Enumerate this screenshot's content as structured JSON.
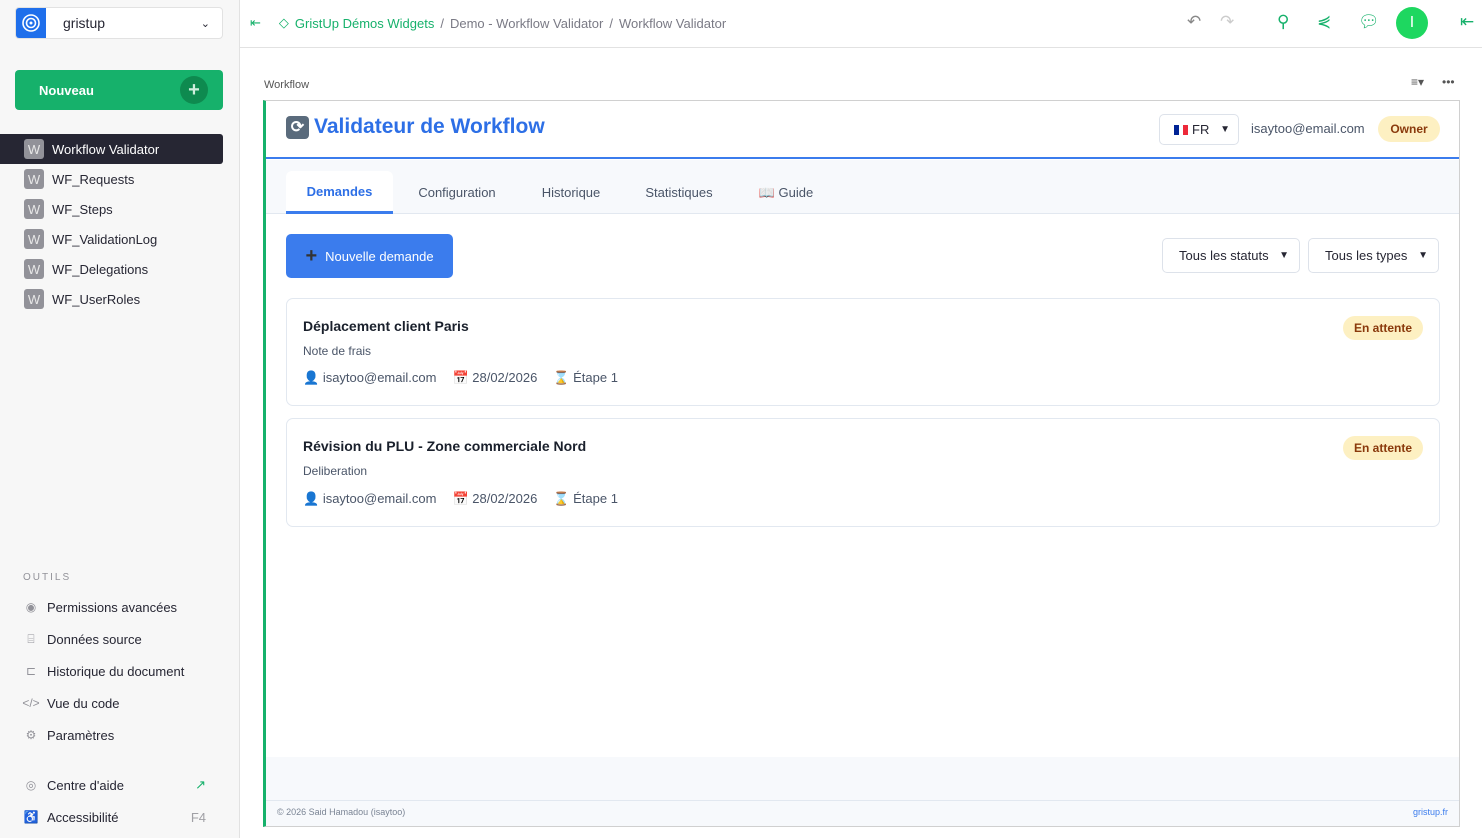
{
  "org": {
    "name": "gristup"
  },
  "sidebar": {
    "new_label": "Nouveau",
    "pages": [
      "Workflow Validator",
      "WF_Requests",
      "WF_Steps",
      "WF_ValidationLog",
      "WF_Delegations",
      "WF_UserRoles"
    ],
    "page_icon_letter": "W",
    "tools_heading": "OUTILS",
    "tools": [
      {
        "icon": "eye-icon",
        "glyph": "◉",
        "label": "Permissions avancées"
      },
      {
        "icon": "database-icon",
        "glyph": "⌸",
        "label": "Données source"
      },
      {
        "icon": "history-icon",
        "glyph": "⊏",
        "label": "Historique du document"
      },
      {
        "icon": "code-icon",
        "glyph": "</>",
        "label": "Vue du code"
      },
      {
        "icon": "gear-icon",
        "glyph": "⚙",
        "label": "Paramètres"
      }
    ],
    "help": {
      "label": "Centre d'aide"
    },
    "accessibility": {
      "label": "Accessibilité",
      "shortcut": "F4"
    }
  },
  "breadcrumb": {
    "workspace": "GristUp Démos Widgets",
    "doc": "Demo - Workflow Validator",
    "page": "Workflow Validator",
    "sep": "/"
  },
  "user": {
    "initial": "I"
  },
  "section": {
    "title": "Workflow"
  },
  "widget": {
    "title": "Validateur de Workflow",
    "lang": "FR",
    "email": "isaytoo@email.com",
    "role": "Owner",
    "tabs": [
      "Demandes",
      "Configuration",
      "Historique",
      "Statistiques",
      "📖 Guide"
    ],
    "new_request": "Nouvelle demande",
    "filters": {
      "status": "Tous les statuts",
      "type": "Tous les types"
    },
    "requests": [
      {
        "title": "Déplacement client Paris",
        "type": "Note de frais",
        "user": "isaytoo@email.com",
        "date": "28/02/2026",
        "step": "Étape 1",
        "status": "En attente"
      },
      {
        "title": "Révision du PLU - Zone commerciale Nord",
        "type": "Deliberation",
        "user": "isaytoo@email.com",
        "date": "28/02/2026",
        "step": "Étape 1",
        "status": "En attente"
      }
    ],
    "footer": {
      "copyright": "© 2026 Said Hamadou (isaytoo)",
      "link": "gristup.fr"
    }
  },
  "colors": {
    "accent": "#16b16b",
    "primary": "#3b7ced",
    "badge_bg": "#fdf0c2"
  }
}
